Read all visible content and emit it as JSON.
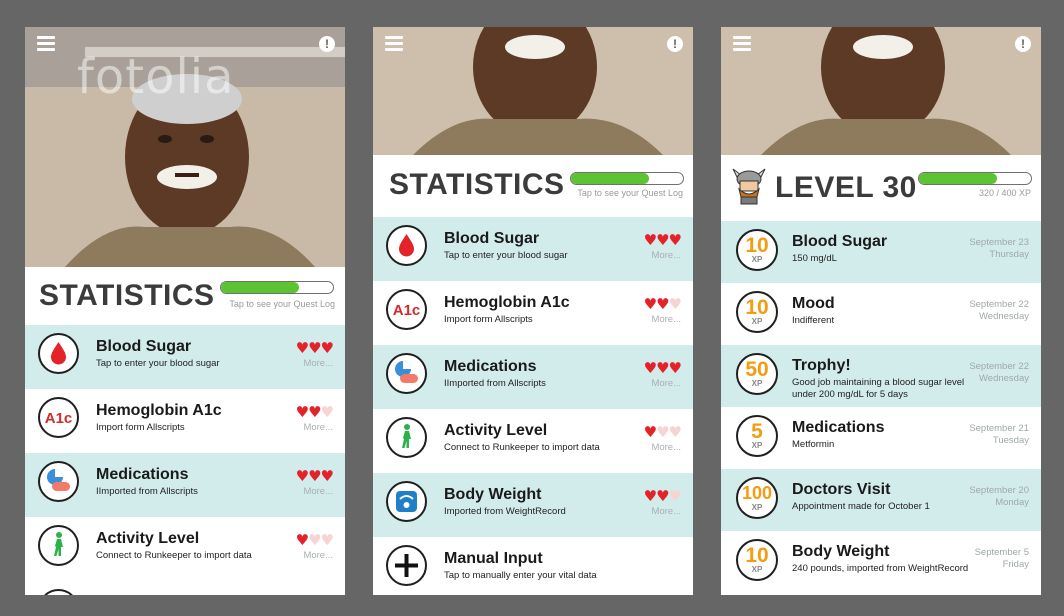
{
  "watermark": "fotolia",
  "screen1": {
    "title": "STATISTICS",
    "progress": 0.7,
    "progress_label": "Tap to see your Quest Log",
    "items": [
      {
        "title": "Blood Sugar",
        "subtitle": "Tap to enter your blood sugar",
        "hearts": 3,
        "more": "More...",
        "icon": "blood-drop-icon"
      },
      {
        "title": "Hemoglobin A1c",
        "subtitle": "Import form Allscripts",
        "hearts": 2,
        "more": "More...",
        "icon": "a1c-icon"
      },
      {
        "title": "Medications",
        "subtitle": "IImported from Allscripts",
        "hearts": 3,
        "more": "More...",
        "icon": "pills-icon"
      },
      {
        "title": "Activity Level",
        "subtitle": "Connect to Runkeeper to import data",
        "hearts": 1,
        "more": "More...",
        "icon": "walking-person-icon"
      }
    ]
  },
  "screen2": {
    "title": "STATISTICS",
    "progress": 0.7,
    "progress_label": "Tap to see your Quest Log",
    "items": [
      {
        "title": "Blood Sugar",
        "subtitle": "Tap to enter your blood sugar",
        "hearts": 3,
        "more": "More...",
        "icon": "blood-drop-icon"
      },
      {
        "title": "Hemoglobin A1c",
        "subtitle": "Import form Allscripts",
        "hearts": 2,
        "more": "More...",
        "icon": "a1c-icon"
      },
      {
        "title": "Medications",
        "subtitle": "IImported from Allscripts",
        "hearts": 3,
        "more": "More...",
        "icon": "pills-icon"
      },
      {
        "title": "Activity Level",
        "subtitle": "Connect to Runkeeper to import data",
        "hearts": 1,
        "more": "More...",
        "icon": "walking-person-icon"
      },
      {
        "title": "Body Weight",
        "subtitle": "Imported from WeightRecord",
        "hearts": 2,
        "more": "More...",
        "icon": "scale-icon"
      },
      {
        "title": "Manual Input",
        "subtitle": "Tap to manually enter your vital data",
        "hearts": null,
        "more": "",
        "icon": "plus-icon"
      }
    ]
  },
  "screen3": {
    "title": "LEVEL 30",
    "progress": 0.7,
    "progress_label": "320 / 400 XP",
    "xp_label": "XP",
    "items": [
      {
        "xp": "10",
        "title": "Blood Sugar",
        "subtitle": "150  mg/dL",
        "date": "September 23",
        "day": "Thursday"
      },
      {
        "xp": "10",
        "title": "Mood",
        "subtitle": "Indifferent",
        "date": "September 22",
        "day": "Wednesday"
      },
      {
        "xp": "50",
        "title": "Trophy!",
        "subtitle": "Good job maintaining a blood sugar level under 200 mg/dL for 5 days",
        "date": "September 22",
        "day": "Wednesday"
      },
      {
        "xp": "5",
        "title": "Medications",
        "subtitle": "Metformin",
        "date": "September 21",
        "day": "Tuesday"
      },
      {
        "xp": "100",
        "title": "Doctors Visit",
        "subtitle": "Appointment made for October 1",
        "date": "September 20",
        "day": "Monday"
      },
      {
        "xp": "10",
        "title": "Body Weight",
        "subtitle": "240 pounds, imported from WeightRecord",
        "date": "September 5",
        "day": "Friday"
      }
    ]
  },
  "colors": {
    "teal": "#d2ecec",
    "accent_green": "#5cc333",
    "heart": "#e3222a",
    "xp_orange": "#f39c12"
  }
}
